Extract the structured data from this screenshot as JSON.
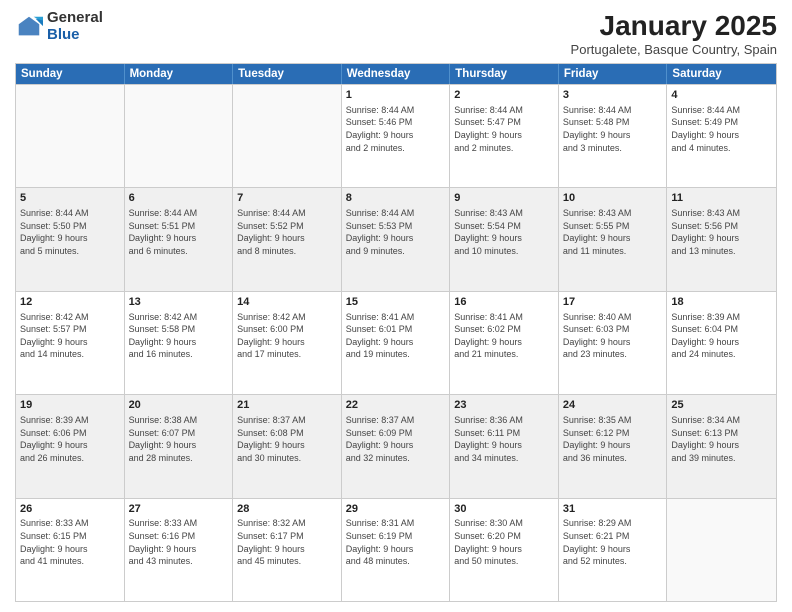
{
  "logo": {
    "general": "General",
    "blue": "Blue"
  },
  "title": "January 2025",
  "subtitle": "Portugalete, Basque Country, Spain",
  "days_header": [
    "Sunday",
    "Monday",
    "Tuesday",
    "Wednesday",
    "Thursday",
    "Friday",
    "Saturday"
  ],
  "weeks": [
    [
      {
        "day": "",
        "info": ""
      },
      {
        "day": "",
        "info": ""
      },
      {
        "day": "",
        "info": ""
      },
      {
        "day": "1",
        "info": "Sunrise: 8:44 AM\nSunset: 5:46 PM\nDaylight: 9 hours\nand 2 minutes."
      },
      {
        "day": "2",
        "info": "Sunrise: 8:44 AM\nSunset: 5:47 PM\nDaylight: 9 hours\nand 2 minutes."
      },
      {
        "day": "3",
        "info": "Sunrise: 8:44 AM\nSunset: 5:48 PM\nDaylight: 9 hours\nand 3 minutes."
      },
      {
        "day": "4",
        "info": "Sunrise: 8:44 AM\nSunset: 5:49 PM\nDaylight: 9 hours\nand 4 minutes."
      }
    ],
    [
      {
        "day": "5",
        "info": "Sunrise: 8:44 AM\nSunset: 5:50 PM\nDaylight: 9 hours\nand 5 minutes."
      },
      {
        "day": "6",
        "info": "Sunrise: 8:44 AM\nSunset: 5:51 PM\nDaylight: 9 hours\nand 6 minutes."
      },
      {
        "day": "7",
        "info": "Sunrise: 8:44 AM\nSunset: 5:52 PM\nDaylight: 9 hours\nand 8 minutes."
      },
      {
        "day": "8",
        "info": "Sunrise: 8:44 AM\nSunset: 5:53 PM\nDaylight: 9 hours\nand 9 minutes."
      },
      {
        "day": "9",
        "info": "Sunrise: 8:43 AM\nSunset: 5:54 PM\nDaylight: 9 hours\nand 10 minutes."
      },
      {
        "day": "10",
        "info": "Sunrise: 8:43 AM\nSunset: 5:55 PM\nDaylight: 9 hours\nand 11 minutes."
      },
      {
        "day": "11",
        "info": "Sunrise: 8:43 AM\nSunset: 5:56 PM\nDaylight: 9 hours\nand 13 minutes."
      }
    ],
    [
      {
        "day": "12",
        "info": "Sunrise: 8:42 AM\nSunset: 5:57 PM\nDaylight: 9 hours\nand 14 minutes."
      },
      {
        "day": "13",
        "info": "Sunrise: 8:42 AM\nSunset: 5:58 PM\nDaylight: 9 hours\nand 16 minutes."
      },
      {
        "day": "14",
        "info": "Sunrise: 8:42 AM\nSunset: 6:00 PM\nDaylight: 9 hours\nand 17 minutes."
      },
      {
        "day": "15",
        "info": "Sunrise: 8:41 AM\nSunset: 6:01 PM\nDaylight: 9 hours\nand 19 minutes."
      },
      {
        "day": "16",
        "info": "Sunrise: 8:41 AM\nSunset: 6:02 PM\nDaylight: 9 hours\nand 21 minutes."
      },
      {
        "day": "17",
        "info": "Sunrise: 8:40 AM\nSunset: 6:03 PM\nDaylight: 9 hours\nand 23 minutes."
      },
      {
        "day": "18",
        "info": "Sunrise: 8:39 AM\nSunset: 6:04 PM\nDaylight: 9 hours\nand 24 minutes."
      }
    ],
    [
      {
        "day": "19",
        "info": "Sunrise: 8:39 AM\nSunset: 6:06 PM\nDaylight: 9 hours\nand 26 minutes."
      },
      {
        "day": "20",
        "info": "Sunrise: 8:38 AM\nSunset: 6:07 PM\nDaylight: 9 hours\nand 28 minutes."
      },
      {
        "day": "21",
        "info": "Sunrise: 8:37 AM\nSunset: 6:08 PM\nDaylight: 9 hours\nand 30 minutes."
      },
      {
        "day": "22",
        "info": "Sunrise: 8:37 AM\nSunset: 6:09 PM\nDaylight: 9 hours\nand 32 minutes."
      },
      {
        "day": "23",
        "info": "Sunrise: 8:36 AM\nSunset: 6:11 PM\nDaylight: 9 hours\nand 34 minutes."
      },
      {
        "day": "24",
        "info": "Sunrise: 8:35 AM\nSunset: 6:12 PM\nDaylight: 9 hours\nand 36 minutes."
      },
      {
        "day": "25",
        "info": "Sunrise: 8:34 AM\nSunset: 6:13 PM\nDaylight: 9 hours\nand 39 minutes."
      }
    ],
    [
      {
        "day": "26",
        "info": "Sunrise: 8:33 AM\nSunset: 6:15 PM\nDaylight: 9 hours\nand 41 minutes."
      },
      {
        "day": "27",
        "info": "Sunrise: 8:33 AM\nSunset: 6:16 PM\nDaylight: 9 hours\nand 43 minutes."
      },
      {
        "day": "28",
        "info": "Sunrise: 8:32 AM\nSunset: 6:17 PM\nDaylight: 9 hours\nand 45 minutes."
      },
      {
        "day": "29",
        "info": "Sunrise: 8:31 AM\nSunset: 6:19 PM\nDaylight: 9 hours\nand 48 minutes."
      },
      {
        "day": "30",
        "info": "Sunrise: 8:30 AM\nSunset: 6:20 PM\nDaylight: 9 hours\nand 50 minutes."
      },
      {
        "day": "31",
        "info": "Sunrise: 8:29 AM\nSunset: 6:21 PM\nDaylight: 9 hours\nand 52 minutes."
      },
      {
        "day": "",
        "info": ""
      }
    ]
  ]
}
